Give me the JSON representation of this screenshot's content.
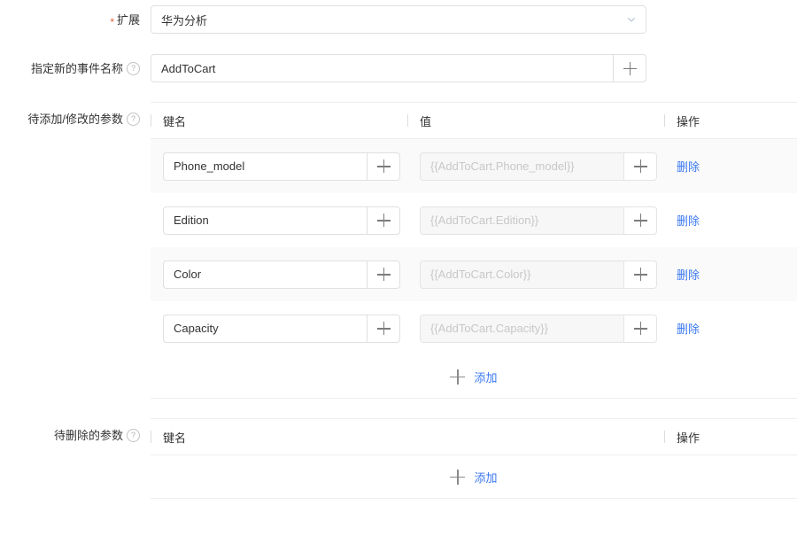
{
  "extension_field": {
    "label": "扩展",
    "required_marker": "*",
    "selected_value": "华为分析",
    "chevron_icon": "chevron-down-icon"
  },
  "event_name_field": {
    "label": "指定新的事件名称",
    "help_icon": "question-circle-icon",
    "value": "AddToCart",
    "suffix_icon": "plus-icon"
  },
  "add_modify_section": {
    "label": "待添加/修改的参数",
    "help_icon": "question-circle-icon",
    "columns": {
      "key": "键名",
      "value": "值",
      "action": "操作"
    },
    "rows": [
      {
        "key": "Phone_model",
        "key_suffix_icon": "plus-icon",
        "value_placeholder": "{{AddToCart.Phone_model}}",
        "value_suffix_icon": "plus-icon",
        "delete_label": "删除"
      },
      {
        "key": "Edition",
        "key_suffix_icon": "plus-icon",
        "value_placeholder": "{{AddToCart.Edition}}",
        "value_suffix_icon": "plus-icon",
        "delete_label": "删除"
      },
      {
        "key": "Color",
        "key_suffix_icon": "plus-icon",
        "value_placeholder": "{{AddToCart.Color}}",
        "value_suffix_icon": "plus-icon",
        "delete_label": "删除"
      },
      {
        "key": "Capacity",
        "key_suffix_icon": "plus-icon",
        "value_placeholder": "{{AddToCart.Capacity}}",
        "value_suffix_icon": "plus-icon",
        "delete_label": "删除"
      }
    ],
    "add_label": "添加",
    "add_icon": "plus-icon"
  },
  "delete_section": {
    "label": "待删除的参数",
    "help_icon": "question-circle-icon",
    "columns": {
      "key": "键名",
      "action": "操作"
    },
    "rows": [],
    "add_label": "添加",
    "add_icon": "plus-icon"
  },
  "colors": {
    "link_blue": "#3a78f2",
    "required_red": "#e8613c",
    "border": "#e0e0e0",
    "stripe": "#fafafa",
    "disabled_bg": "#f7f7f7",
    "placeholder_text": "#c8c8c8"
  }
}
